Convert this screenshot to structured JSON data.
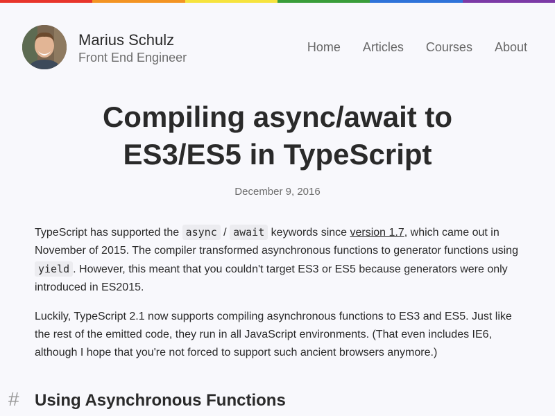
{
  "colors": {
    "rainbow": [
      "#e8352b",
      "#f39423",
      "#f6e33e",
      "#3a9d3a",
      "#2f73d9",
      "#7c3aa6"
    ],
    "background": "#f8f8fc"
  },
  "header": {
    "name": "Marius Schulz",
    "tagline": "Front End Engineer",
    "nav": [
      "Home",
      "Articles",
      "Courses",
      "About"
    ]
  },
  "article": {
    "title_line1": "Compiling async/await to",
    "title_line2": "ES3/ES5 in TypeScript",
    "date": "December 9, 2016",
    "p1": {
      "t1": "TypeScript has supported the ",
      "code1": "async",
      "slash": " / ",
      "code2": "await",
      "t2": " keywords since ",
      "link": "version 1.7",
      "t3": ", which came out in November of 2015. The compiler transformed asynchronous functions to generator functions using ",
      "code3": "yield",
      "t4": ". However, this meant that you couldn't target ES3 or ES5 because generators were only introduced in ES2015."
    },
    "p2": "Luckily, TypeScript 2.1 now supports compiling asynchronous functions to ES3 and ES5. Just like the rest of the emitted code, they run in all JavaScript environments. (That even includes IE6, although I hope that you're not forced to support such ancient browsers anymore.)",
    "heading_hash": "#",
    "heading": "Using Asynchronous Functions"
  }
}
